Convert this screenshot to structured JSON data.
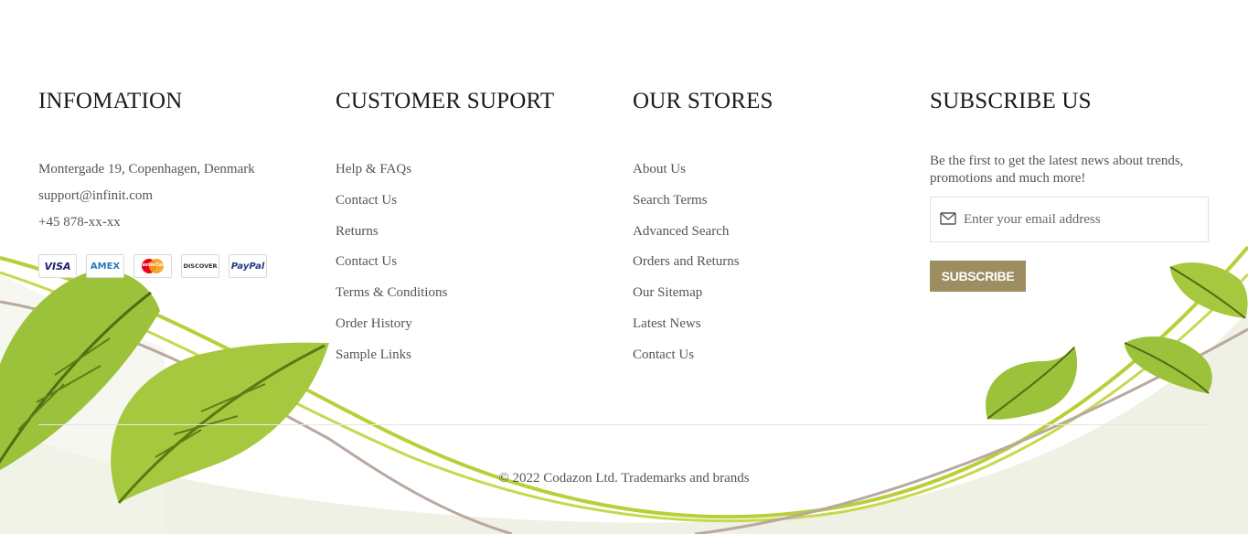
{
  "footer": {
    "information": {
      "heading": "INFOMATION",
      "address": "Montergade 19, Copenhagen, Denmark",
      "email": "support@infinit.com",
      "phone": "+45 878-xx-xx",
      "payments": [
        {
          "label": "VISA",
          "color": "#1a1f71"
        },
        {
          "label": "AMEX",
          "color": "#2e77bb"
        },
        {
          "label": "MasterCard",
          "color": "#eb001b"
        },
        {
          "label": "DISCOVER",
          "color": "#333333"
        },
        {
          "label": "PayPal",
          "color": "#253b80"
        }
      ]
    },
    "customer_support": {
      "heading": "CUSTOMER SUPORT",
      "links": [
        "Help & FAQs",
        "Contact Us",
        "Returns",
        "Contact Us",
        "Terms & Conditions",
        "Order History",
        "Sample Links"
      ]
    },
    "our_stores": {
      "heading": "OUR STORES",
      "links": [
        "About Us",
        "Search Terms",
        "Advanced Search",
        "Orders and Returns",
        "Our Sitemap",
        "Latest News",
        "Contact Us"
      ]
    },
    "subscribe": {
      "heading": "SUBSCRIBE US",
      "description": "Be the first to get the latest news about trends, promotions and much more!",
      "email_placeholder": "Enter your email address",
      "button_label": "SUBSCRIBE",
      "button_color": "#9c8e60"
    },
    "copyright": "© 2022 Codazon Ltd. Trademarks and brands"
  }
}
